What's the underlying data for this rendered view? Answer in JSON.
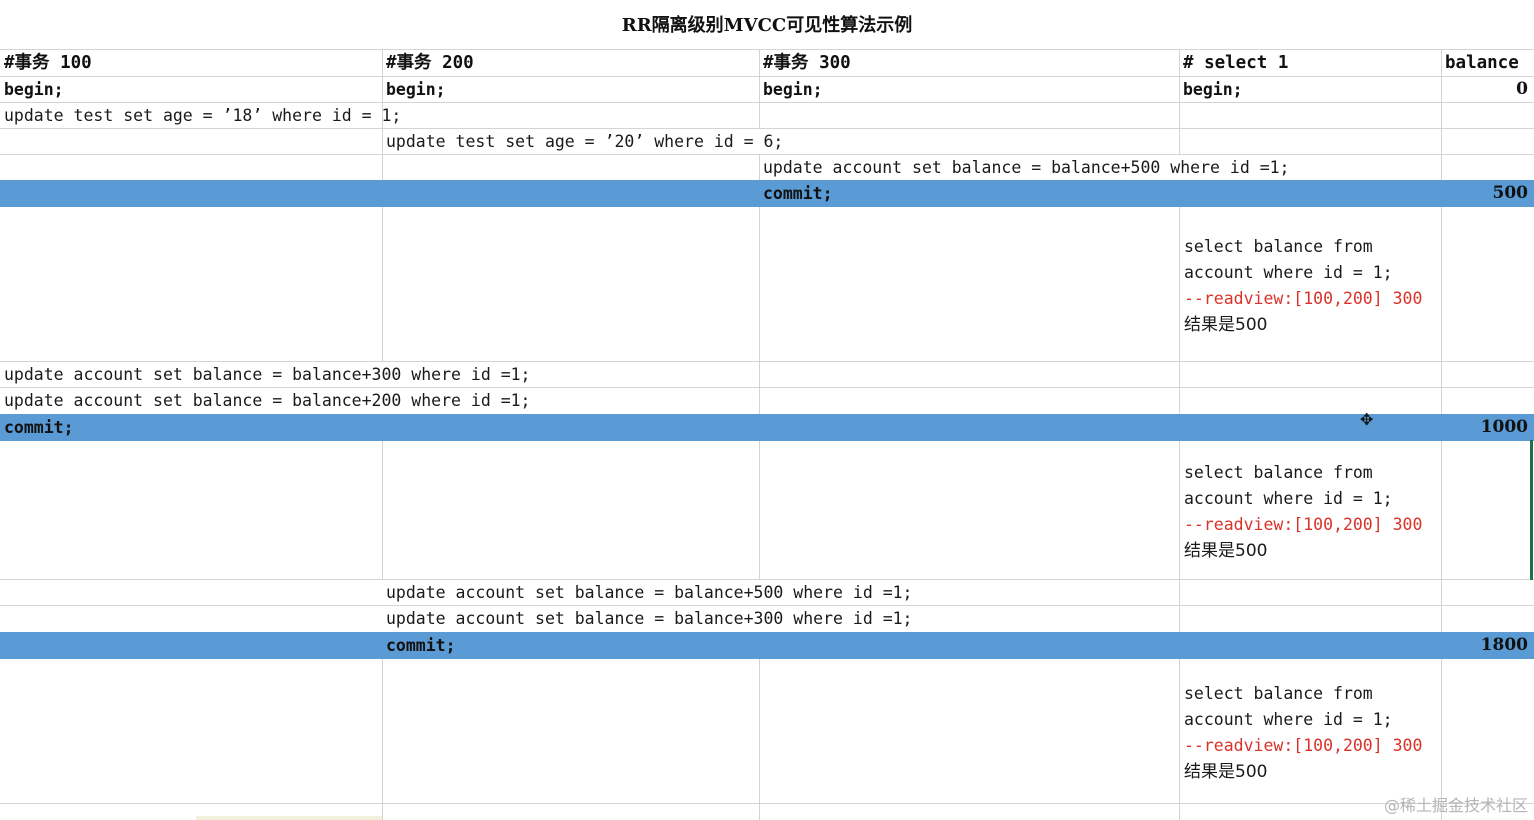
{
  "title": "RR隔离级别MVCC可见性算法示例",
  "headers": {
    "col1": "#事务 100",
    "col2": "#事务 200",
    "col3": "#事务 300",
    "col4": "# select 1",
    "col5": "balance"
  },
  "begin_rows": {
    "col1": "begin;",
    "col2": "begin;",
    "col3": "begin;",
    "col4": "begin;",
    "balance": "0"
  },
  "statements": {
    "t100_update_test": "update test set age = ’18’ where id = 1;",
    "t200_update_test": "update test set age = ’20’ where id = 6;",
    "t300_update_account": "update account set balance = balance+500 where id =1;",
    "t300_commit": "commit;",
    "t100_update_300": "update account set balance = balance+300 where id =1;",
    "t100_update_200": "update account set balance = balance+200 where id =1;",
    "t100_commit": "commit;",
    "t200_update_500": "update account set balance = balance+500 where id =1;",
    "t200_update_300": "update account set balance = balance+300 where id =1;",
    "t200_commit": "commit;"
  },
  "balances": {
    "after_t300_commit": "500",
    "after_t100_commit": "1000",
    "after_t200_commit": "1800"
  },
  "selects": [
    {
      "line1": "select balance from",
      "line2": "account where id = 1;",
      "readview": "--readview:[100,200] 300",
      "result": "结果是500"
    },
    {
      "line1": "select balance from",
      "line2": "account where id = 1;",
      "readview": "--readview:[100,200] 300",
      "result": "结果是500"
    },
    {
      "line1": "select balance from",
      "line2": "account where id = 1;",
      "readview": "--readview:[100,200] 300",
      "result": "结果是500"
    }
  ],
  "watermark": "@稀土掘金技术社区",
  "icons": {
    "cursor": "move-cursor-icon"
  }
}
